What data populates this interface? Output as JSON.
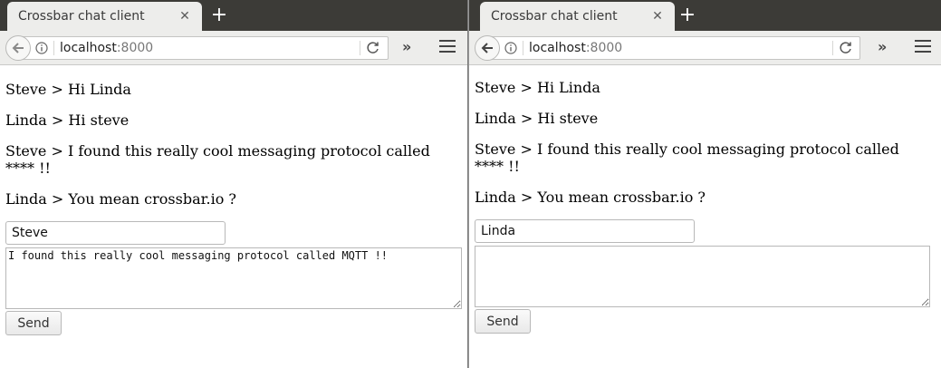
{
  "windows": [
    {
      "tab_title": "Crossbar chat client",
      "url_host": "localhost",
      "url_port": ":8000",
      "messages": [
        "Steve > Hi Linda",
        "Linda > Hi steve",
        "Steve > I found this really cool messaging protocol called **** !!",
        "Linda > You mean crossbar.io ?"
      ],
      "name_value": "Steve",
      "message_value": "I found this really cool messaging protocol called MQTT !!",
      "send_label": "Send"
    },
    {
      "tab_title": "Crossbar chat client",
      "url_host": "localhost",
      "url_port": ":8000",
      "messages": [
        "Steve > Hi Linda",
        "Linda > Hi steve",
        "Steve > I found this really cool messaging protocol called **** !!",
        "Linda > You mean crossbar.io ?"
      ],
      "name_value": "Linda",
      "message_value": "",
      "send_label": "Send"
    }
  ],
  "icons": {
    "tab_close": "close-icon",
    "new_tab": "plus-icon",
    "back": "back-arrow-icon",
    "site_info": "info-icon",
    "reload": "reload-icon",
    "overflow": "chevron-double-right-icon",
    "menu": "hamburger-menu-icon"
  },
  "colors": {
    "tabbar": "#3c3b37",
    "toolbar": "#ededeb",
    "page_bg": "#ffffff"
  }
}
